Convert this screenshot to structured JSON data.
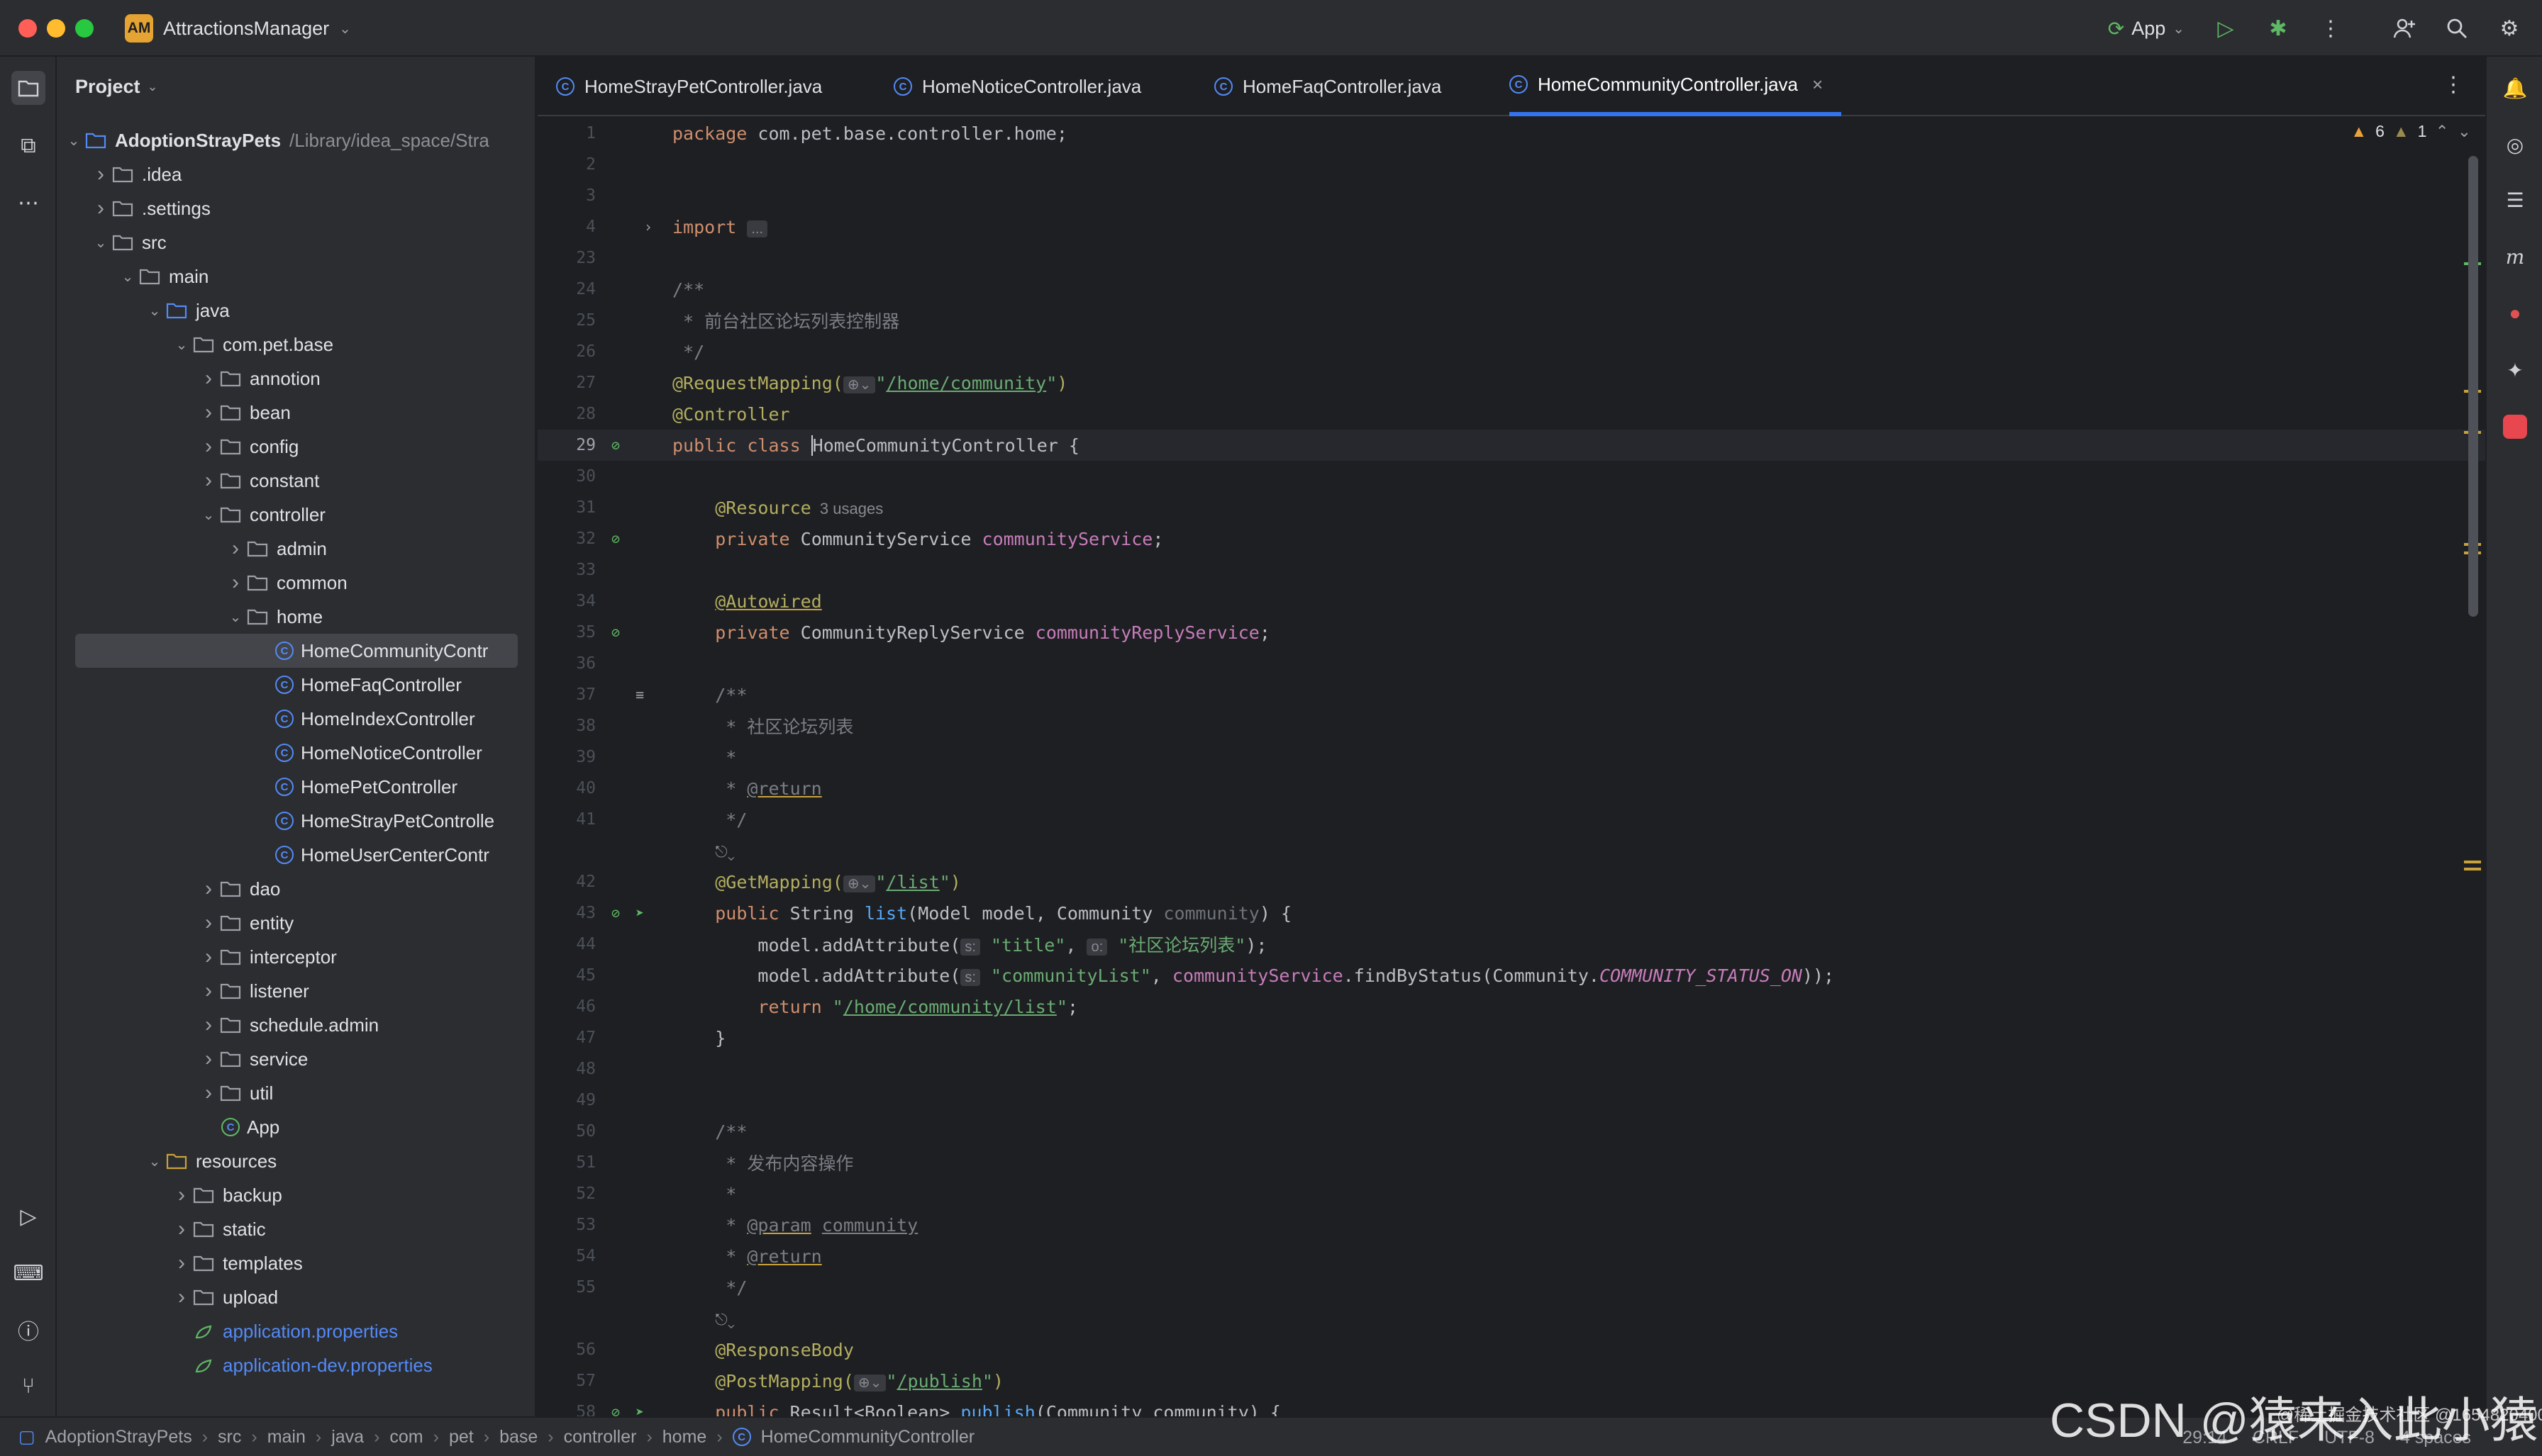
{
  "titlebar": {
    "project_badge": "AM",
    "project_name": "AttractionsManager",
    "run_config": "App",
    "icons": [
      "chevron-down-icon",
      "run-icon",
      "debug-icon",
      "more-icon",
      "add-user-icon",
      "search-icon",
      "settings-icon"
    ]
  },
  "project_panel": {
    "title": "Project",
    "tree": [
      {
        "label": "AdoptionStrayPets",
        "extra": "/Library/idea_space/Stra",
        "depth": 0,
        "arrow": "down",
        "icon": "module",
        "bold": true
      },
      {
        "label": ".idea",
        "depth": 1,
        "arrow": "right",
        "icon": "folder"
      },
      {
        "label": ".settings",
        "depth": 1,
        "arrow": "right",
        "icon": "folder"
      },
      {
        "label": "src",
        "depth": 1,
        "arrow": "down",
        "icon": "folder"
      },
      {
        "label": "main",
        "depth": 2,
        "arrow": "down",
        "icon": "folder"
      },
      {
        "label": "java",
        "depth": 3,
        "arrow": "down",
        "icon": "src-folder"
      },
      {
        "label": "com.pet.base",
        "depth": 4,
        "arrow": "down",
        "icon": "package"
      },
      {
        "label": "annotion",
        "depth": 5,
        "arrow": "right",
        "icon": "package"
      },
      {
        "label": "bean",
        "depth": 5,
        "arrow": "right",
        "icon": "package"
      },
      {
        "label": "config",
        "depth": 5,
        "arrow": "right",
        "icon": "package"
      },
      {
        "label": "constant",
        "depth": 5,
        "arrow": "right",
        "icon": "package"
      },
      {
        "label": "controller",
        "depth": 5,
        "arrow": "down",
        "icon": "package"
      },
      {
        "label": "admin",
        "depth": 6,
        "arrow": "right",
        "icon": "package"
      },
      {
        "label": "common",
        "depth": 6,
        "arrow": "right",
        "icon": "package"
      },
      {
        "label": "home",
        "depth": 6,
        "arrow": "down",
        "icon": "package"
      },
      {
        "label": "HomeCommunityContr",
        "depth": 7,
        "arrow": "",
        "icon": "class",
        "selected": true
      },
      {
        "label": "HomeFaqController",
        "depth": 7,
        "arrow": "",
        "icon": "class"
      },
      {
        "label": "HomeIndexController",
        "depth": 7,
        "arrow": "",
        "icon": "class"
      },
      {
        "label": "HomeNoticeController",
        "depth": 7,
        "arrow": "",
        "icon": "class"
      },
      {
        "label": "HomePetController",
        "depth": 7,
        "arrow": "",
        "icon": "class"
      },
      {
        "label": "HomeStrayPetControlle",
        "depth": 7,
        "arrow": "",
        "icon": "class"
      },
      {
        "label": "HomeUserCenterContr",
        "depth": 7,
        "arrow": "",
        "icon": "class"
      },
      {
        "label": "dao",
        "depth": 5,
        "arrow": "right",
        "icon": "package"
      },
      {
        "label": "entity",
        "depth": 5,
        "arrow": "right",
        "icon": "package"
      },
      {
        "label": "interceptor",
        "depth": 5,
        "arrow": "right",
        "icon": "package"
      },
      {
        "label": "listener",
        "depth": 5,
        "arrow": "right",
        "icon": "package"
      },
      {
        "label": "schedule.admin",
        "depth": 5,
        "arrow": "right",
        "icon": "package"
      },
      {
        "label": "service",
        "depth": 5,
        "arrow": "right",
        "icon": "package"
      },
      {
        "label": "util",
        "depth": 5,
        "arrow": "right",
        "icon": "package"
      },
      {
        "label": "App",
        "depth": 5,
        "arrow": "",
        "icon": "spring-class"
      },
      {
        "label": "resources",
        "depth": 3,
        "arrow": "down",
        "icon": "res-folder"
      },
      {
        "label": "backup",
        "depth": 4,
        "arrow": "right",
        "icon": "folder"
      },
      {
        "label": "static",
        "depth": 4,
        "arrow": "right",
        "icon": "folder"
      },
      {
        "label": "templates",
        "depth": 4,
        "arrow": "right",
        "icon": "folder"
      },
      {
        "label": "upload",
        "depth": 4,
        "arrow": "right",
        "icon": "folder"
      },
      {
        "label": "application.properties",
        "depth": 4,
        "arrow": "",
        "icon": "properties",
        "blue": true
      },
      {
        "label": "application-dev.properties",
        "depth": 4,
        "arrow": "",
        "icon": "properties",
        "blue": true
      }
    ]
  },
  "tabs": [
    {
      "label": "HomeStrayPetController.java"
    },
    {
      "label": "HomeNoticeController.java"
    },
    {
      "label": "HomeFaqController.java"
    },
    {
      "label": "HomeCommunityController.java",
      "active": true,
      "close": "×"
    }
  ],
  "inspections": {
    "warnings": "6",
    "weak": "1"
  },
  "code_lines": [
    {
      "n": "1",
      "t": [
        [
          "kw",
          "package "
        ],
        [
          "",
          "com.pet.base.controller.home;"
        ]
      ]
    },
    {
      "n": "2",
      "t": []
    },
    {
      "n": "3",
      "t": []
    },
    {
      "n": "4",
      "t": [
        [
          "kw",
          "import "
        ],
        [
          "chip",
          "..."
        ]
      ],
      "fold": true
    },
    {
      "n": "23",
      "t": []
    },
    {
      "n": "24",
      "t": [
        [
          "cm",
          "/**"
        ]
      ]
    },
    {
      "n": "25",
      "t": [
        [
          "cm",
          " * 前台社区论坛列表控制器"
        ]
      ]
    },
    {
      "n": "26",
      "t": [
        [
          "cm",
          " */"
        ]
      ]
    },
    {
      "n": "27",
      "t": [
        [
          "an",
          "@RequestMapping("
        ],
        [
          "chip",
          "⊕⌄"
        ],
        [
          "str",
          "\""
        ],
        [
          "str link",
          "/home/community"
        ],
        [
          "str",
          "\""
        ],
        [
          "an",
          ")"
        ]
      ]
    },
    {
      "n": "28",
      "t": [
        [
          "an",
          "@Controller"
        ]
      ]
    },
    {
      "n": "29",
      "t": [
        [
          "kw",
          "public class "
        ],
        [
          "",
          "HomeCommunityController {"
        ]
      ],
      "cur": true,
      "gutter": "bean"
    },
    {
      "n": "30",
      "t": []
    },
    {
      "n": "31",
      "t": [
        [
          "",
          "    "
        ],
        [
          "an",
          "@Resource"
        ],
        [
          "hint",
          "  3 usages"
        ]
      ]
    },
    {
      "n": "32",
      "t": [
        [
          "",
          "    "
        ],
        [
          "kw",
          "private "
        ],
        [
          "",
          "CommunityService "
        ],
        [
          "fld",
          "communityService"
        ],
        [
          "",
          ";"
        ]
      ],
      "gutter": "bean"
    },
    {
      "n": "33",
      "t": []
    },
    {
      "n": "34",
      "t": [
        [
          "",
          "    "
        ],
        [
          "an ul",
          "@Autowired"
        ]
      ]
    },
    {
      "n": "35",
      "t": [
        [
          "",
          "    "
        ],
        [
          "kw",
          "private "
        ],
        [
          "",
          "CommunityReplyService "
        ],
        [
          "fld",
          "communityReplyService"
        ],
        [
          "",
          ";"
        ]
      ],
      "gutter": "bean"
    },
    {
      "n": "36",
      "t": []
    },
    {
      "n": "37",
      "t": [
        [
          "",
          "    "
        ],
        [
          "cm",
          "/**"
        ]
      ],
      "gutter": "doc"
    },
    {
      "n": "38",
      "t": [
        [
          "",
          "    "
        ],
        [
          "cm",
          " * 社区论坛列表"
        ]
      ]
    },
    {
      "n": "39",
      "t": [
        [
          "",
          "    "
        ],
        [
          "cm",
          " *"
        ]
      ]
    },
    {
      "n": "40",
      "t": [
        [
          "",
          "    "
        ],
        [
          "cm",
          " * "
        ],
        [
          "cm ul",
          "@return"
        ]
      ]
    },
    {
      "n": "41",
      "t": [
        [
          "",
          "    "
        ],
        [
          "cm",
          " */"
        ]
      ]
    },
    {
      "n": "",
      "t": [
        [
          "",
          "    "
        ],
        [
          "hint",
          "⎋⌄"
        ]
      ]
    },
    {
      "n": "42",
      "t": [
        [
          "",
          "    "
        ],
        [
          "an",
          "@GetMapping("
        ],
        [
          "chip",
          "⊕⌄"
        ],
        [
          "str",
          "\""
        ],
        [
          "str link",
          "/list"
        ],
        [
          "str",
          "\""
        ],
        [
          "an",
          ")"
        ]
      ]
    },
    {
      "n": "43",
      "t": [
        [
          "",
          "    "
        ],
        [
          "kw",
          "public "
        ],
        [
          "",
          "String "
        ],
        [
          "fn",
          "list"
        ],
        [
          "",
          "(Model model, Community "
        ],
        [
          "par",
          "community"
        ],
        [
          "",
          ") {"
        ]
      ],
      "gutter": "web"
    },
    {
      "n": "44",
      "t": [
        [
          "",
          "        model.addAttribute("
        ],
        [
          "chip",
          "s:"
        ],
        [
          "str",
          " \"title\""
        ],
        [
          "",
          ", "
        ],
        [
          "chip",
          "o:"
        ],
        [
          "str",
          " \"社区论坛列表\""
        ],
        [
          "",
          ");"
        ]
      ]
    },
    {
      "n": "45",
      "t": [
        [
          "",
          "        model.addAttribute("
        ],
        [
          "chip",
          "s:"
        ],
        [
          "str",
          " \"communityList\""
        ],
        [
          "",
          ", "
        ],
        [
          "fld",
          "communityService"
        ],
        [
          "",
          ".findByStatus(Community."
        ],
        [
          "cn",
          "COMMUNITY_STATUS_ON"
        ],
        [
          "",
          "));"
        ]
      ]
    },
    {
      "n": "46",
      "t": [
        [
          "",
          "        "
        ],
        [
          "kw",
          "return "
        ],
        [
          "str",
          "\""
        ],
        [
          "str link",
          "/home/community/list"
        ],
        [
          "str",
          "\""
        ],
        [
          "",
          ";"
        ]
      ]
    },
    {
      "n": "47",
      "t": [
        [
          "",
          "    }"
        ]
      ]
    },
    {
      "n": "48",
      "t": []
    },
    {
      "n": "49",
      "t": []
    },
    {
      "n": "50",
      "t": [
        [
          "",
          "    "
        ],
        [
          "cm",
          "/**"
        ]
      ]
    },
    {
      "n": "51",
      "t": [
        [
          "",
          "    "
        ],
        [
          "cm",
          " * 发布内容操作"
        ]
      ]
    },
    {
      "n": "52",
      "t": [
        [
          "",
          "    "
        ],
        [
          "cm",
          " *"
        ]
      ]
    },
    {
      "n": "53",
      "t": [
        [
          "",
          "    "
        ],
        [
          "cm",
          " * "
        ],
        [
          "cm ul",
          "@param"
        ],
        [
          "cm",
          " "
        ],
        [
          "cm link",
          "community"
        ]
      ]
    },
    {
      "n": "54",
      "t": [
        [
          "",
          "    "
        ],
        [
          "cm",
          " * "
        ],
        [
          "cm ul",
          "@return"
        ]
      ]
    },
    {
      "n": "55",
      "t": [
        [
          "",
          "    "
        ],
        [
          "cm",
          " */"
        ]
      ]
    },
    {
      "n": "",
      "t": [
        [
          "",
          "    "
        ],
        [
          "hint",
          "⎋⌄"
        ]
      ]
    },
    {
      "n": "56",
      "t": [
        [
          "",
          "    "
        ],
        [
          "an",
          "@ResponseBody"
        ]
      ]
    },
    {
      "n": "57",
      "t": [
        [
          "",
          "    "
        ],
        [
          "an",
          "@PostMapping("
        ],
        [
          "chip",
          "⊕⌄"
        ],
        [
          "str",
          "\""
        ],
        [
          "str link",
          "/publish"
        ],
        [
          "str",
          "\""
        ],
        [
          "an",
          ")"
        ]
      ]
    },
    {
      "n": "58",
      "t": [
        [
          "",
          "    "
        ],
        [
          "kw",
          "public "
        ],
        [
          "",
          "Result<Boolean> "
        ],
        [
          "fn",
          "publish"
        ],
        [
          "",
          "(Community community) {"
        ]
      ],
      "gutter": "web"
    }
  ],
  "statusbar": {
    "breadcrumbs": [
      "AdoptionStrayPets",
      "src",
      "main",
      "java",
      "com",
      "pet",
      "base",
      "controller",
      "home",
      "HomeCommunityController"
    ],
    "position": "29:14",
    "line_sep": "CRLF",
    "encoding": "UTF-8",
    "indent": "4 spaces"
  },
  "watermark": {
    "main": "CSDN @猿来入此小猿",
    "sub": "@稀土掘金技术社区 @1654820400"
  }
}
